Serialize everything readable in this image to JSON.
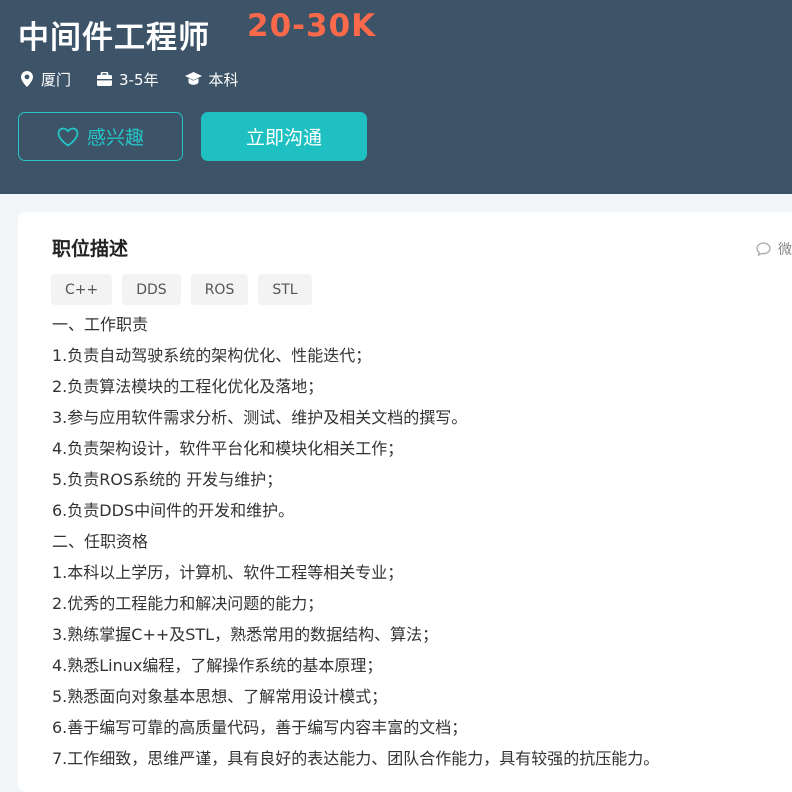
{
  "job": {
    "title": "中间件工程师",
    "salary": "20-30K",
    "meta": [
      {
        "icon": "location-pin-icon",
        "label": "厦门"
      },
      {
        "icon": "briefcase-icon",
        "label": "3-5年"
      },
      {
        "icon": "graduation-cap-icon",
        "label": "本科"
      }
    ]
  },
  "actions": {
    "interest_label": "感兴趣",
    "chat_label": "立即沟通"
  },
  "description": {
    "title": "职位描述",
    "share_label": "微",
    "tags": [
      "C++",
      "DDS",
      "ROS",
      "STL"
    ],
    "lines": [
      "一、工作职责",
      "1.负责自动驾驶系统的架构优化、性能迭代；",
      "2.负责算法模块的工程化优化及落地；",
      "3.参与应用软件需求分析、测试、维护及相关文档的撰写。",
      "4.负责架构设计，软件平台化和模块化相关工作；",
      "5.负责ROS系统的 开发与维护；",
      "6.负责DDS中间件的开发和维护。",
      "二、任职资格",
      "1.本科以上学历，计算机、软件工程等相关专业；",
      "2.优秀的工程能力和解决问题的能力；",
      "3.熟练掌握C++及STL，熟悉常用的数据结构、算法；",
      "4.熟悉Linux编程，了解操作系统的基本原理；",
      "5.熟悉面向对象基本思想、了解常用设计模式；",
      "6.善于编写可靠的高质量代码，善于编写内容丰富的文档；",
      "7.工作细致，思维严谨，具有良好的表达能力、团队合作能力，具有较强的抗压能力。"
    ]
  },
  "colors": {
    "header_bg": "#3c5368",
    "salary": "#fa6a4a",
    "accent": "#1ec0c2"
  }
}
